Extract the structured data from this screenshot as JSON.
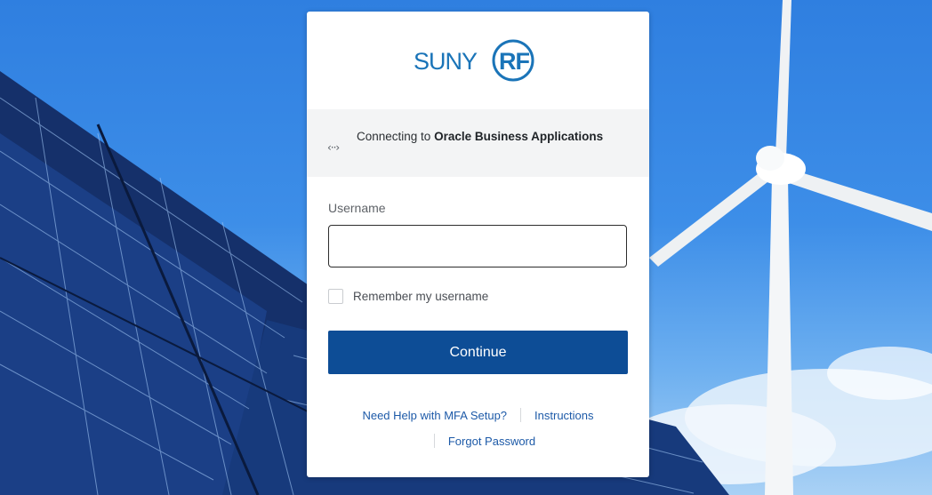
{
  "brand": {
    "logo_suny": "SUNY",
    "logo_rf": "RF",
    "color_primary": "#1a74b8",
    "color_button": "#0d4d96"
  },
  "connect": {
    "prefix": "Connecting to ",
    "app_name": "Oracle Business Applications",
    "icon": "connect-arrows-icon"
  },
  "form": {
    "username_label": "Username",
    "username_value": "",
    "username_placeholder": "",
    "remember_label": "Remember my username",
    "remember_checked": false,
    "continue_label": "Continue"
  },
  "links": {
    "mfa_help": "Need Help with MFA Setup?",
    "instructions": "Instructions",
    "forgot_password": "Forgot Password"
  }
}
